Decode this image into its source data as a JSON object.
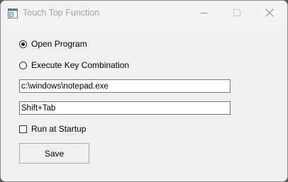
{
  "window": {
    "title": "Touch Top Function",
    "controls": {
      "minimize_icon": "minimize-icon",
      "maximize_icon": "maximize-icon",
      "close_icon": "close-icon"
    }
  },
  "options": {
    "open_program": {
      "label": "Open Program",
      "selected": true
    },
    "execute_key_combination": {
      "label": "Execute Key Combination",
      "selected": false
    }
  },
  "fields": {
    "program_path": {
      "value": "c:\\windows\\notepad.exe"
    },
    "key_combination": {
      "value": "Shift+Tab"
    }
  },
  "startup": {
    "label": "Run at Startup",
    "checked": false
  },
  "actions": {
    "save_label": "Save"
  }
}
